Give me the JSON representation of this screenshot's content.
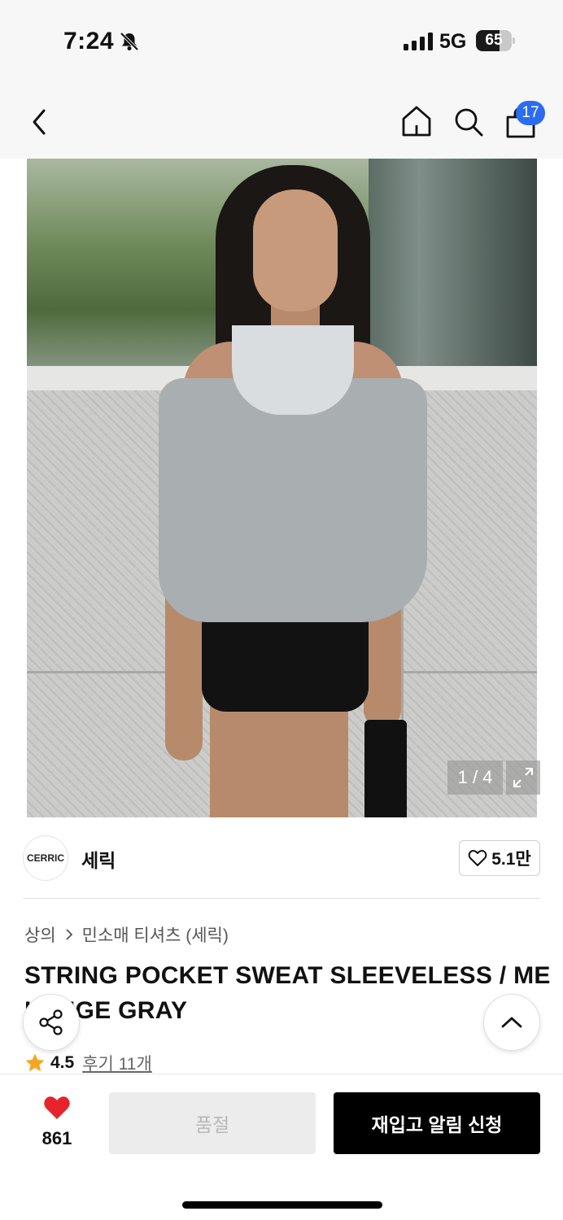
{
  "status_bar": {
    "time": "7:24",
    "network": "5G",
    "battery_level": "65",
    "battery_fraction": 0.65,
    "icons": [
      "bell-slash-icon",
      "signal-icon",
      "battery-icon"
    ]
  },
  "nav": {
    "cart_count": "17",
    "icons": [
      "chevron-left-icon",
      "home-icon",
      "search-icon",
      "shopping-bag-icon"
    ]
  },
  "gallery": {
    "counter": "1 / 4",
    "icons": [
      "expand-icon"
    ]
  },
  "brand": {
    "logo_text": "CERRIC",
    "name": "세릭",
    "like_count": "5.1만"
  },
  "product": {
    "breadcrumb": [
      "상의",
      "민소매 티셔츠 (세릭)"
    ],
    "title_line1": "STRING POCKET SWEAT SLEEVELESS / ME",
    "title_line2": "LANGE GRAY",
    "rating": "4.5",
    "review_label": "후기 11개"
  },
  "bottom_bar": {
    "wish_count": "861",
    "soldout_label": "품절",
    "restock_label": "재입고 알림 신청"
  },
  "colors": {
    "accent_blue": "#2b6cf0",
    "heart_red": "#e8242b",
    "star_orange": "#f5a623",
    "button_black": "#000000"
  }
}
